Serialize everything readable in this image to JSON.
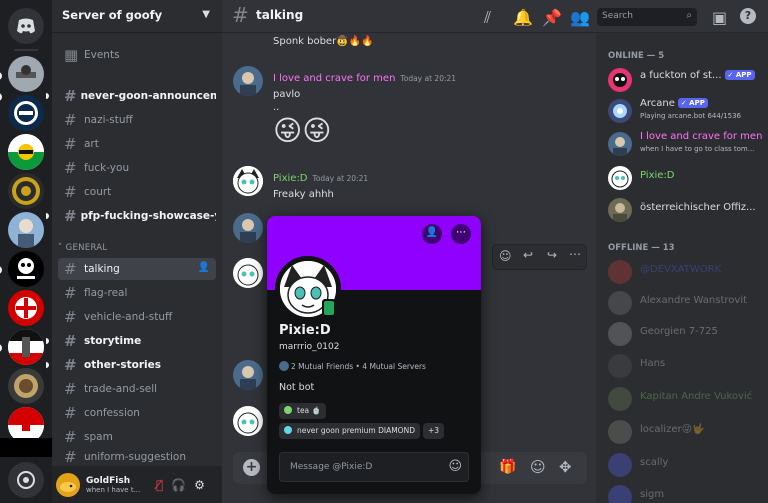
{
  "server": {
    "name": "Server of goofy"
  },
  "channels": [
    {
      "name": "Events",
      "type": "events"
    },
    {
      "name": "never-goon-announcem...",
      "unread": true
    },
    {
      "name": "nazi-stuff"
    },
    {
      "name": "art"
    },
    {
      "name": "fuck-you"
    },
    {
      "name": "court"
    },
    {
      "name": "pfp-fucking-showcase-y...",
      "unread": true
    }
  ],
  "category": "GENERAL",
  "general_channels": [
    {
      "name": "talking",
      "active": true
    },
    {
      "name": "flag-real"
    },
    {
      "name": "vehicle-and-stuff"
    },
    {
      "name": "storytime",
      "unread": true
    },
    {
      "name": "other-stories",
      "unread": true
    },
    {
      "name": "trade-and-sell"
    },
    {
      "name": "confession"
    },
    {
      "name": "spam"
    },
    {
      "name": "uniform-suggestion"
    }
  ],
  "current_channel": "talking",
  "search": {
    "placeholder": "Search"
  },
  "user": {
    "name": "GoldFish",
    "status": "when I have t..."
  },
  "messages": [
    {
      "text": "Sponk bober🤠🔥🔥"
    },
    {
      "author": "I love and crave for men",
      "time": "Today at 20:21",
      "lines": [
        "pavlo",
        ".."
      ],
      "emoji": "😜😜",
      "color": "#ff73fa"
    },
    {
      "author": "Pixie:D",
      "time": "Today at 20:21",
      "lines": [
        "Freaky ahhh"
      ],
      "color": "#7dd56f"
    }
  ],
  "composer": {
    "placeholder": "Message #talking"
  },
  "members": {
    "online_header": "ONLINE — 5",
    "offline_header": "OFFLINE — 13",
    "online": [
      {
        "name": "a fuckton of st...",
        "badge": "APP",
        "color": "#dbdee1"
      },
      {
        "name": "Arcane",
        "badge": "APP",
        "sub": "Playing arcane.bot 644/1536",
        "color": "#dbdee1"
      },
      {
        "name": "I love and crave for men",
        "sub": "when I have to go to class tom...",
        "color": "#ff73fa"
      },
      {
        "name": "Pixie:D",
        "color": "#7dd56f"
      },
      {
        "name": "österreichischer Offiz...",
        "color": "#dbdee1"
      }
    ],
    "offline": [
      {
        "name": "@DEVXATWORK",
        "color": "#5865f2"
      },
      {
        "name": "Alexandre Wanstrovit",
        "color": "#dbdee1"
      },
      {
        "name": "Georgien 7-725",
        "color": "#dbdee1"
      },
      {
        "name": "Hans",
        "color": "#dbdee1"
      },
      {
        "name": "Kapitan Andre Vuković",
        "color": "#7dd56f"
      },
      {
        "name": "localizer😜🤟",
        "color": "#dbdee1"
      },
      {
        "name": "scally",
        "color": "#dbdee1"
      },
      {
        "name": "sigm",
        "color": "#dbdee1"
      }
    ]
  },
  "popout": {
    "name": "Pixie:D",
    "username": "marrrio_0102",
    "mutual": "2 Mutual Friends • 4 Mutual Servers",
    "note": "Not bot",
    "roles": [
      {
        "label": "tea 🍵",
        "color": "#7dd56f"
      },
      {
        "label": "never goon premium DIAMOND",
        "color": "#66d4e8"
      }
    ],
    "more_roles": "+3",
    "message_placeholder": "Message @Pixie:D",
    "banner_color": "#8f00ff"
  }
}
